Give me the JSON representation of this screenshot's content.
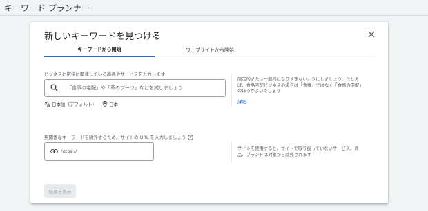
{
  "page": {
    "title": "キーワード プランナー"
  },
  "dialog": {
    "title": "新しいキーワードを見つける",
    "close_icon": "close-icon",
    "tabs": [
      {
        "label": "キーワードから開始",
        "active": true
      },
      {
        "label": "ウェブサイトから開始",
        "active": false
      }
    ],
    "keywords_section": {
      "label": "ビジネスに密接に関連している商品やサービスを入力します",
      "placeholder": "「食事の宅配」や「革のブーツ」などを試しましょう",
      "language": "日本語（デフォルト）",
      "location": "日本",
      "hint_line1": "限定的または一般的になりすぎないようにしましょう。たとえ",
      "hint_line2": "ば、食品宅配ビジネスの場合は「食事」ではなく「食事の宅配」",
      "hint_line3": "のほうがよいでしょう",
      "hint_link": "詳細"
    },
    "url_section": {
      "label": "無関係なキーワードを除外するため、サイトの URL を入力しましょう",
      "placeholder": "https://",
      "hint_line1": "サイトを使用すると、サイトで取り扱っていないサービス、商",
      "hint_line2": "品、ブランドは対象から除外されます"
    },
    "results_button": "結果を表示"
  },
  "colors": {
    "accent": "#1a73e8",
    "link": "#1a73e8",
    "disabled_bg": "#e8eaed"
  }
}
